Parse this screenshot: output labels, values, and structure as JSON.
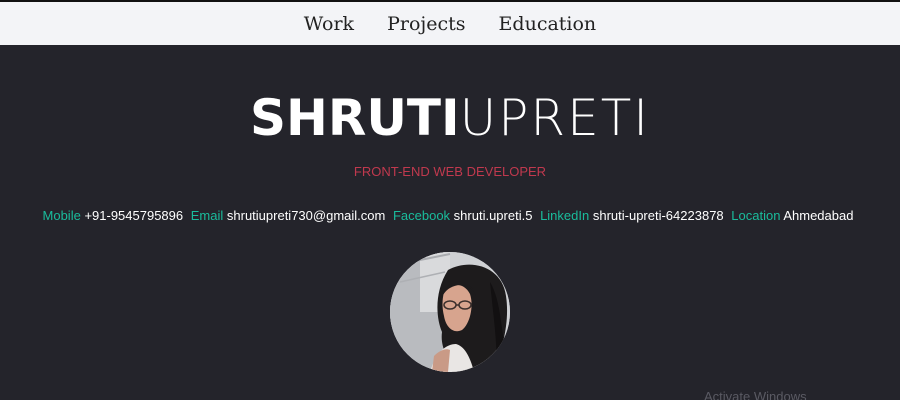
{
  "nav": {
    "items": [
      {
        "label": "Work"
      },
      {
        "label": "Projects"
      },
      {
        "label": "Education"
      }
    ]
  },
  "hero": {
    "first_name": "SHRUTI",
    "last_name": "UPRETI",
    "subtitle": "FRONT-END WEB DEVELOPER"
  },
  "contacts": [
    {
      "label": "Mobile",
      "value": "+91-9545795896"
    },
    {
      "label": "Email",
      "value": "shrutiupreti730@gmail.com"
    },
    {
      "label": "Facebook",
      "value": "shruti.upreti.5"
    },
    {
      "label": "LinkedIn",
      "value": "shruti-upreti-64223878"
    },
    {
      "label": "Location",
      "value": "Ahmedabad"
    }
  ],
  "watermark": {
    "text": "Activate Windows"
  },
  "colors": {
    "background": "#24242b",
    "nav_background": "#f3f4f7",
    "accent_teal": "#1abc9c",
    "subtitle_red": "#c0394e"
  },
  "icons": {
    "avatar": "profile-photo"
  }
}
